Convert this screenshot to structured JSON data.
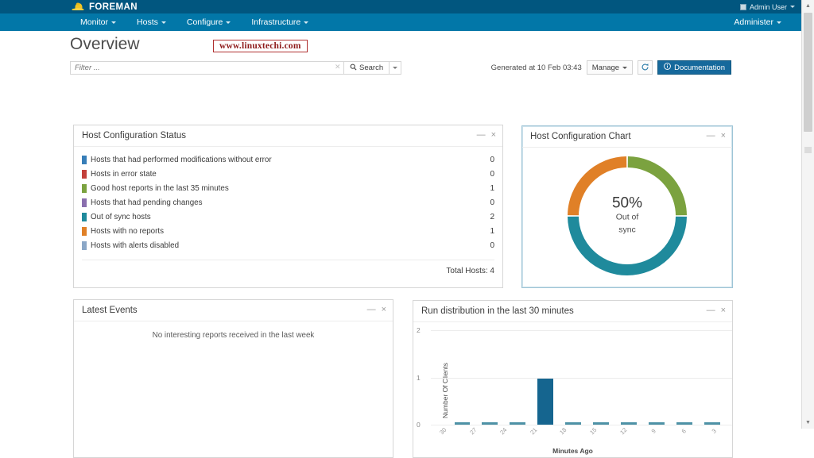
{
  "brand": {
    "name": "FOREMAN",
    "logo_icon": "hardhat-icon",
    "user": "Admin User",
    "user_icon": "user-avatar-icon",
    "user_caret": "chevron-down-icon"
  },
  "nav": {
    "items": [
      {
        "label": "Monitor",
        "caret": "chevron-down-icon"
      },
      {
        "label": "Hosts",
        "caret": "chevron-down-icon"
      },
      {
        "label": "Configure",
        "caret": "chevron-down-icon"
      },
      {
        "label": "Infrastructure",
        "caret": "chevron-down-icon"
      }
    ],
    "right": {
      "label": "Administer",
      "caret": "chevron-down-icon"
    }
  },
  "page": {
    "title": "Overview",
    "watermark": "www.linuxtechi.com"
  },
  "search": {
    "placeholder": "Filter ...",
    "value": "",
    "clear_icon": "close-icon",
    "button_label": "Search",
    "button_icon": "search-icon",
    "dropdown_icon": "chevron-down-icon"
  },
  "toolbar": {
    "generated_at": "Generated at 10 Feb 03:43",
    "manage_label": "Manage",
    "manage_caret": "chevron-down-icon",
    "refresh_icon": "refresh-icon",
    "documentation_label": "Documentation",
    "documentation_icon": "info-circle-icon",
    "documentation_color": "#16699c"
  },
  "panel_actions": {
    "minimize": "—",
    "close": "×"
  },
  "host_status": {
    "title": "Host Configuration Status",
    "rows": [
      {
        "label": "Hosts that had performed modifications without error",
        "count": "0",
        "color": "#377eb8"
      },
      {
        "label": "Hosts in error state",
        "count": "0",
        "color": "#c3403a"
      },
      {
        "label": "Good host reports in the last 35 minutes",
        "count": "1",
        "color": "#7ba23f"
      },
      {
        "label": "Hosts that had pending changes",
        "count": "0",
        "color": "#8a6fae"
      },
      {
        "label": "Out of sync hosts",
        "count": "2",
        "color": "#1f8a9c"
      },
      {
        "label": "Hosts with no reports",
        "count": "1",
        "color": "#e08027"
      },
      {
        "label": "Hosts with alerts disabled",
        "count": "0",
        "color": "#8ba7c7"
      }
    ],
    "total": "Total Hosts: 4"
  },
  "host_chart": {
    "title": "Host Configuration Chart",
    "center_percent": "50%",
    "center_line1": "Out of",
    "center_line2": "sync"
  },
  "latest_events": {
    "title": "Latest Events",
    "empty_message": "No interesting reports received in the last week"
  },
  "run_distribution": {
    "title": "Run distribution in the last 30 minutes"
  },
  "chart_data": [
    {
      "type": "pie",
      "title": "Host Configuration Chart",
      "subtype": "donut",
      "center_label": "50% Out of sync",
      "categories": [
        "Good host reports in the last 35 minutes",
        "Out of sync hosts",
        "Hosts with no reports"
      ],
      "values": [
        1,
        2,
        1
      ],
      "percentages": [
        25,
        50,
        25
      ],
      "colors": [
        "#7ba23f",
        "#1f8a9c",
        "#e08027"
      ],
      "total": 4,
      "legend": "none"
    },
    {
      "type": "bar",
      "title": "Run distribution in the last 30 minutes",
      "xlabel": "Minutes Ago",
      "ylabel": "Number Of Clients",
      "categories": [
        "30",
        "27",
        "24",
        "21",
        "18",
        "15",
        "12",
        "9",
        "6",
        "3"
      ],
      "values": [
        0,
        0,
        0,
        1,
        0,
        0,
        0,
        0,
        0,
        0
      ],
      "ylim": [
        0,
        2
      ],
      "yticks": [
        "0",
        "1",
        "2"
      ],
      "grid": true,
      "bar_color": "#15658f",
      "legend": "none"
    }
  ]
}
